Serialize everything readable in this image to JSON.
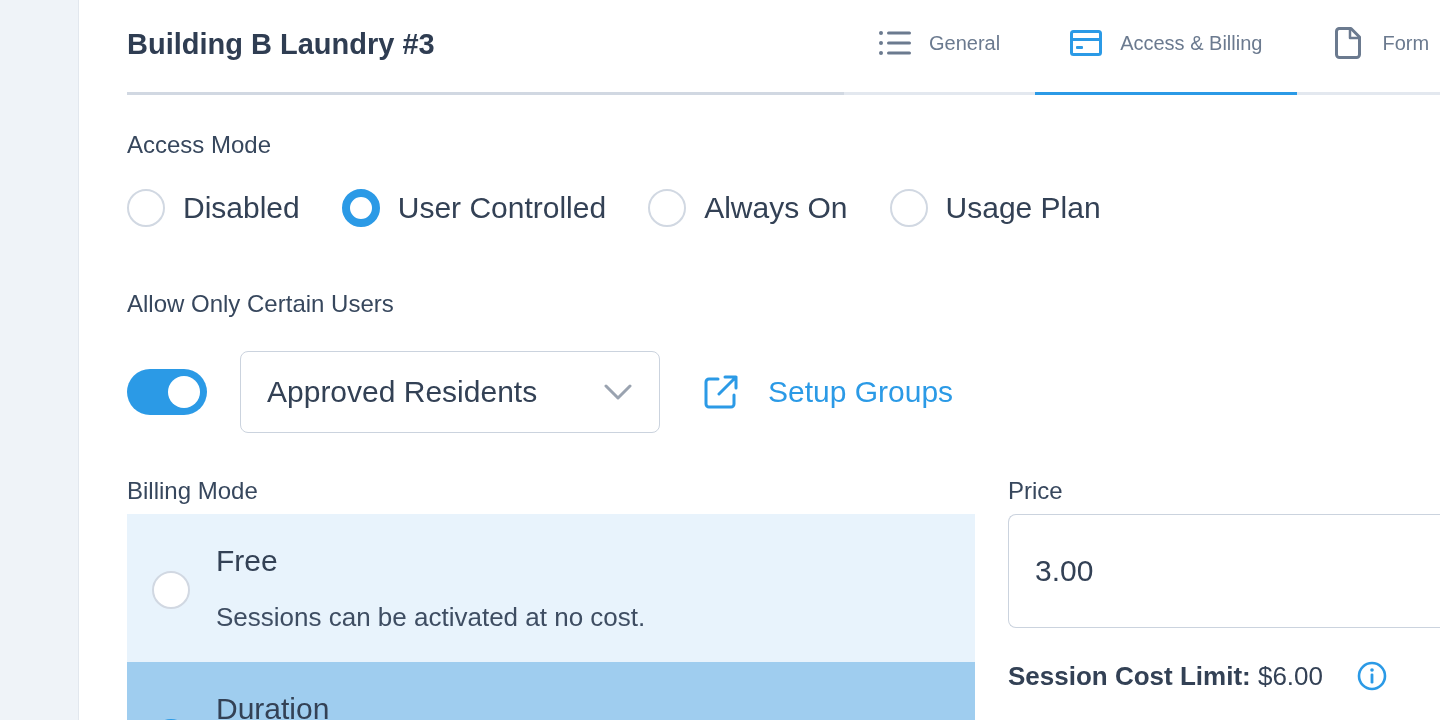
{
  "header": {
    "title": "Building B Laundry #3"
  },
  "tabs": [
    {
      "label": "General",
      "kind": "list",
      "selected": false
    },
    {
      "label": "Access & Billing",
      "kind": "card",
      "selected": true
    },
    {
      "label": "Form",
      "kind": "document",
      "selected": false
    }
  ],
  "access_mode": {
    "label": "Access Mode",
    "options": [
      {
        "label": "Disabled",
        "selected": false
      },
      {
        "label": "User Controlled",
        "selected": true
      },
      {
        "label": "Always On",
        "selected": false
      },
      {
        "label": "Usage Plan",
        "selected": false
      }
    ]
  },
  "allowed_users": {
    "label": "Allow Only Certain Users",
    "toggle": {
      "on": true
    },
    "group_select": {
      "value": "Approved Residents"
    },
    "setup_link": "Setup Groups"
  },
  "billing_mode": {
    "label": "Billing Mode",
    "options": [
      {
        "title": "Free",
        "description": "Sessions can be activated at no cost.",
        "selected": false
      },
      {
        "title": "Duration",
        "selected": true
      }
    ]
  },
  "price": {
    "label": "Price",
    "value": "3.00",
    "session_cost_limit": "**Session Cost Limit:** $6.00"
  }
}
